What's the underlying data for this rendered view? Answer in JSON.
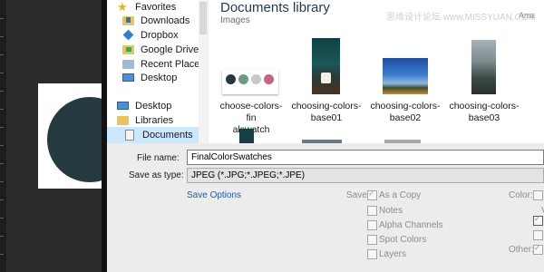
{
  "navigation": {
    "items": [
      {
        "label": "Favorites",
        "icon": "star-icon"
      },
      {
        "label": "Downloads",
        "icon": "downloads-folder-icon"
      },
      {
        "label": "Dropbox",
        "icon": "dropbox-icon"
      },
      {
        "label": "Google Drive",
        "icon": "google-drive-icon"
      },
      {
        "label": "Recent Places",
        "icon": "recent-places-icon"
      },
      {
        "label": "Desktop",
        "icon": "desktop-icon"
      },
      {
        "label": "Desktop",
        "icon": "desktop-icon"
      },
      {
        "label": "Libraries",
        "icon": "libraries-icon"
      },
      {
        "label": "Documents",
        "icon": "documents-icon"
      }
    ],
    "selected": "Documents"
  },
  "library": {
    "title": "Documents library",
    "subtitle": "Images",
    "arrange_label": "Arra"
  },
  "watermark": "思缘设计论坛  www.MISSYUAN.COM",
  "files": [
    {
      "name_line1": "choose-colors-fin",
      "name_line2": "alswatch"
    },
    {
      "name_line1": "choosing-colors-",
      "name_line2": "base01"
    },
    {
      "name_line1": "choosing-colors-",
      "name_line2": "base02"
    },
    {
      "name_line1": "choosing-colors-",
      "name_line2": "base03"
    }
  ],
  "swatch_colors": [
    "#253a40",
    "#6d9a86",
    "#c9c9c9",
    "#c6647a"
  ],
  "form": {
    "filename_label": "File name:",
    "filename_value": "FinalColorSwatches",
    "savetype_label": "Save as type:",
    "savetype_value": "JPEG (*.JPG;*.JPEG;*.JPE)",
    "save_options_link": "Save Options",
    "save_label": "Save:",
    "options": [
      {
        "label": "As a Copy",
        "checked": true
      },
      {
        "label": "Notes",
        "checked": false
      },
      {
        "label": "Alpha Channels",
        "checked": false
      },
      {
        "label": "Spot Colors",
        "checked": false
      },
      {
        "label": "Layers",
        "checked": false
      }
    ],
    "color_label": "Color:",
    "other_label": "Other:"
  }
}
